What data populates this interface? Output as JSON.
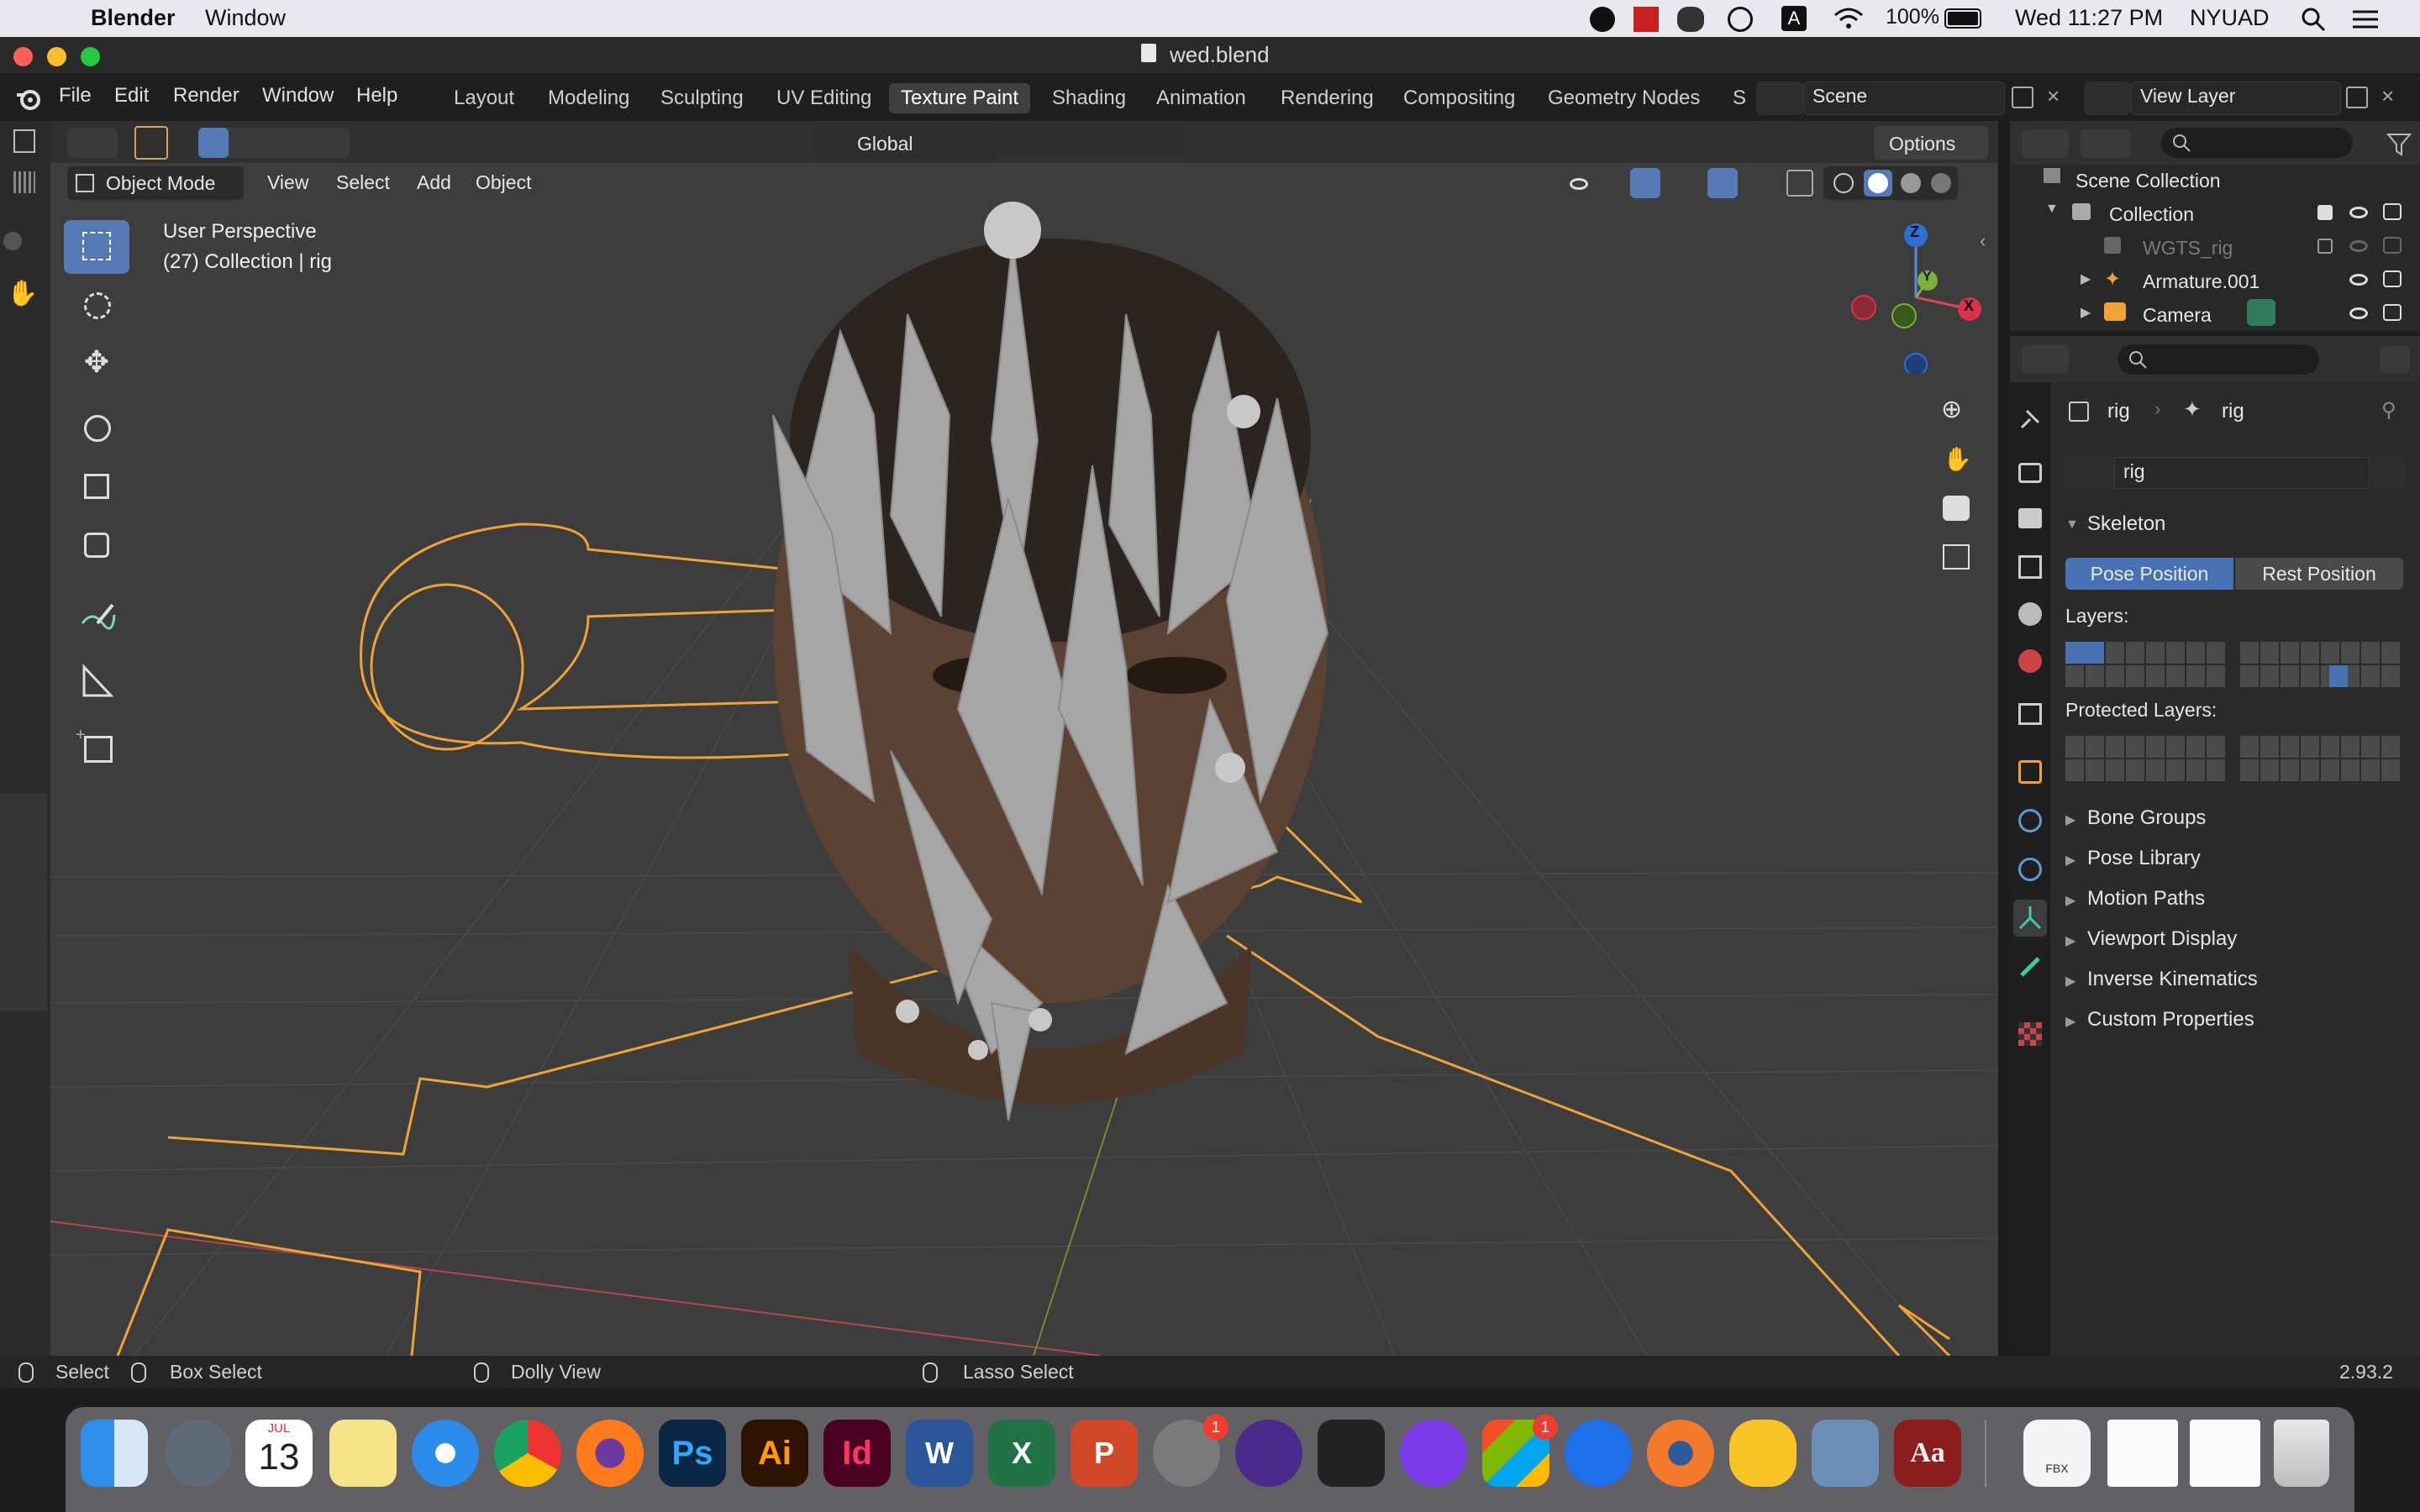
{
  "menubar": {
    "app_name": "Blender",
    "menu_window": "Window",
    "battery": "100%",
    "clock": "Wed 11:27 PM",
    "user": "NYUAD",
    "input_source": "A"
  },
  "window": {
    "title": "wed.blend"
  },
  "topbar": {
    "menus": [
      "File",
      "Edit",
      "Render",
      "Window",
      "Help"
    ],
    "workspaces": [
      "Layout",
      "Modeling",
      "Sculpting",
      "UV Editing",
      "Texture Paint",
      "Shading",
      "Animation",
      "Rendering",
      "Compositing",
      "Geometry Nodes",
      "S"
    ],
    "active_workspace": "Texture Paint",
    "scene_label": "Scene",
    "view_layer_label": "View Layer"
  },
  "tool_header": {
    "orientation": "Global",
    "options": "Options"
  },
  "viewport_header": {
    "mode": "Object Mode",
    "menus": [
      "View",
      "Select",
      "Add",
      "Object"
    ]
  },
  "viewport": {
    "perspective_text": "User Perspective",
    "collection_text": "(27) Collection | rig",
    "gizmo": {
      "x": "X",
      "y": "Y",
      "z": "Z"
    }
  },
  "outliner": {
    "root": "Scene Collection",
    "items": [
      {
        "label": "Collection",
        "visible": true
      },
      {
        "label": "WGTS_rig",
        "visible": false
      },
      {
        "label": "Armature.001",
        "visible": true
      },
      {
        "label": "Camera",
        "visible": true
      }
    ]
  },
  "properties": {
    "breadcrumb_object": "rig",
    "breadcrumb_data": "rig",
    "datablock_name": "rig",
    "skeleton_panel": "Skeleton",
    "pose_position": "Pose Position",
    "rest_position": "Rest Position",
    "layers_label": "Layers:",
    "protected_layers_label": "Protected Layers:",
    "collapsed_panels": [
      "Bone Groups",
      "Pose Library",
      "Motion Paths",
      "Viewport Display",
      "Inverse Kinematics",
      "Custom Properties"
    ]
  },
  "statusbar": {
    "select": "Select",
    "box_select": "Box Select",
    "dolly_view": "Dolly View",
    "lasso_select": "Lasso Select",
    "version": "2.93.2"
  },
  "dock": {
    "calendar_month": "JUL",
    "calendar_day": "13",
    "badges": {
      "system_prefs": "1",
      "microsoft": "1"
    },
    "labels": {
      "photoshop": "Ps",
      "illustrator": "Ai",
      "indesign": "Id",
      "word": "W",
      "excel": "X",
      "powerpoint": "P",
      "dictionary": "Aa",
      "fbx": "FBX"
    }
  }
}
